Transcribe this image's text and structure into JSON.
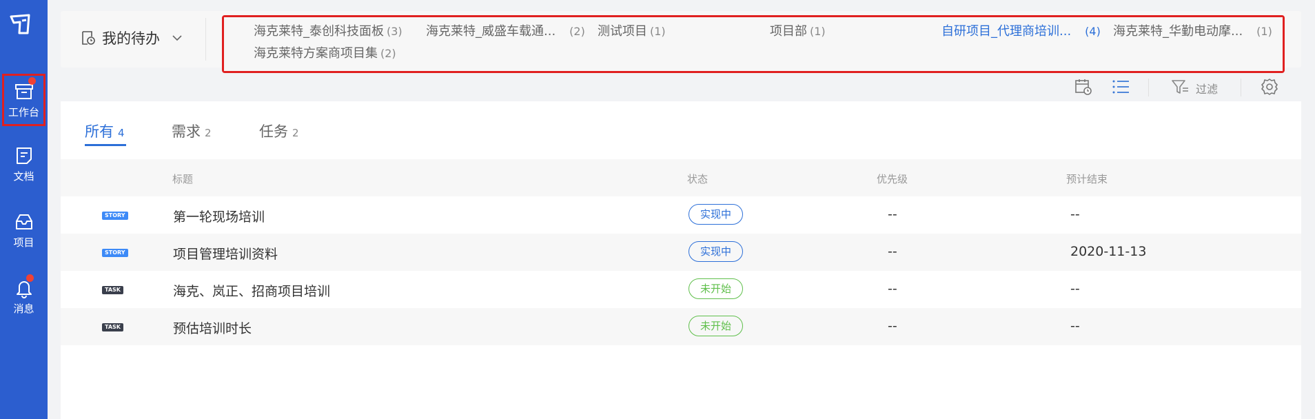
{
  "sidebar": {
    "items": [
      {
        "label": "工作台",
        "icon": "archive-box-icon"
      },
      {
        "label": "文档",
        "icon": "document-icon"
      },
      {
        "label": "项目",
        "icon": "inbox-icon"
      },
      {
        "label": "消息",
        "icon": "bell-icon"
      }
    ]
  },
  "topbar": {
    "todo_label": "我的待办",
    "projects": [
      {
        "name": "海克莱特_泰创科技面板",
        "count": "(3)"
      },
      {
        "name": "海克莱特_威盛车载通...",
        "count": "(2)"
      },
      {
        "name": "测试项目",
        "count": "(1)"
      },
      {
        "name": "项目部",
        "count": "(1)"
      },
      {
        "name": "自研项目_代理商培训...",
        "count": "(4)"
      },
      {
        "name": "海克莱特_华勤电动摩...",
        "count": "(1)"
      },
      {
        "name": "海克莱特方案商项目集",
        "count": "(2)"
      }
    ]
  },
  "toolbar": {
    "filter_label": "过滤"
  },
  "tabs": [
    {
      "label": "所有",
      "count": "4"
    },
    {
      "label": "需求",
      "count": "2"
    },
    {
      "label": "任务",
      "count": "2"
    }
  ],
  "table": {
    "columns": [
      "标题",
      "状态",
      "优先级",
      "预计结束"
    ],
    "rows": [
      {
        "type": "STORY",
        "title": "第一轮现场培训",
        "status": "实现中",
        "priority": "--",
        "due": "--"
      },
      {
        "type": "STORY",
        "title": "项目管理培训资料",
        "status": "实现中",
        "priority": "--",
        "due": "2020-11-13"
      },
      {
        "type": "TASK",
        "title": "海克、岚正、招商项目培训",
        "status": "未开始",
        "priority": "--",
        "due": "--"
      },
      {
        "type": "TASK",
        "title": "预估培训时长",
        "status": "未开始",
        "priority": "--",
        "due": "--"
      }
    ]
  },
  "colors": {
    "sidebar_bg": "#2c5ecf",
    "accent": "#2c6fd8",
    "status_doing": "#2c6fd8",
    "status_todo": "#5fbf4b",
    "highlight_box": "#e02020"
  }
}
